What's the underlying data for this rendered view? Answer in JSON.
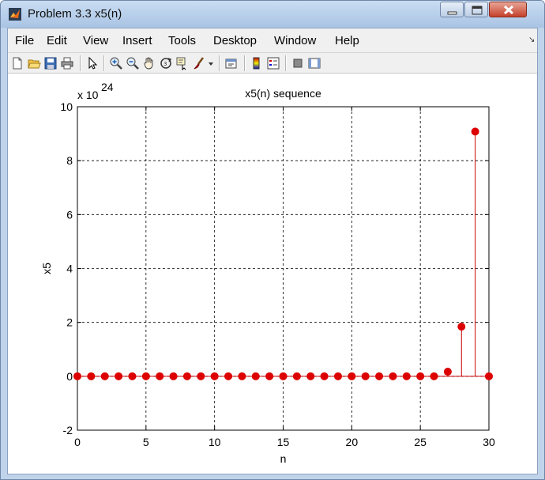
{
  "window": {
    "title": "Problem 3.3 x5(n)"
  },
  "menu": {
    "items": [
      "File",
      "Edit",
      "View",
      "Insert",
      "Tools",
      "Desktop",
      "Window",
      "Help"
    ]
  },
  "toolbar": {
    "icons": [
      "new-figure-icon",
      "open-file-icon",
      "save-icon",
      "print-icon",
      "edit-plot-arrow-icon",
      "zoom-in-icon",
      "zoom-out-icon",
      "pan-hand-icon",
      "rotate-3d-icon",
      "data-cursor-icon",
      "brush-icon",
      "link-plot-icon",
      "colorbar-icon",
      "legend-icon",
      "hide-plot-tools-icon",
      "show-plot-tools-icon"
    ]
  },
  "colors": {
    "stem": "#cc0000",
    "marker": "#dd0000",
    "baseline": "#cc0000"
  },
  "chart_data": {
    "type": "stem",
    "title": "x5(n) sequence",
    "xlabel": "n",
    "ylabel": "x5",
    "exponent_label": "x 10",
    "exponent_power": "24",
    "xlim": [
      0,
      30
    ],
    "ylim": [
      -2,
      10
    ],
    "xticks": [
      "0",
      "5",
      "10",
      "15",
      "20",
      "25",
      "30"
    ],
    "yticks": [
      "-2",
      "0",
      "2",
      "4",
      "6",
      "8",
      "10"
    ],
    "grid": true,
    "x": [
      0,
      1,
      2,
      3,
      4,
      5,
      6,
      7,
      8,
      9,
      10,
      11,
      12,
      13,
      14,
      15,
      16,
      17,
      18,
      19,
      20,
      21,
      22,
      23,
      24,
      25,
      26,
      27,
      28,
      29,
      30
    ],
    "values": [
      0,
      0,
      0,
      0,
      0,
      0,
      0,
      0,
      0,
      0,
      0,
      0,
      0,
      0,
      0,
      0,
      0,
      0,
      0,
      0,
      0,
      0,
      0,
      0,
      0,
      0,
      0,
      0.17,
      1.84,
      9.08,
      0
    ]
  }
}
